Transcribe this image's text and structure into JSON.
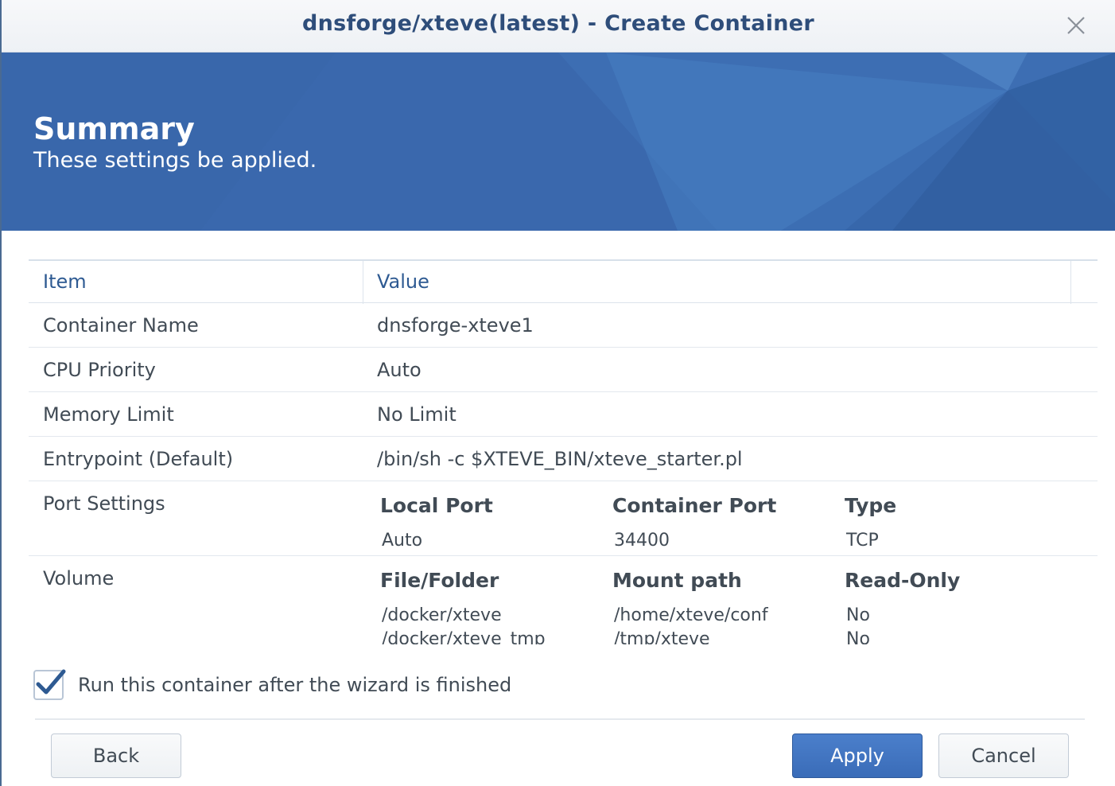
{
  "window": {
    "title": "dnsforge/xteve(latest) - Create Container"
  },
  "banner": {
    "heading": "Summary",
    "subtitle": "These settings be applied."
  },
  "table": {
    "headers": {
      "item": "Item",
      "value": "Value"
    },
    "rows": [
      {
        "item": "Container Name",
        "value": "dnsforge-xteve1"
      },
      {
        "item": "CPU Priority",
        "value": "Auto"
      },
      {
        "item": "Memory Limit",
        "value": "No Limit"
      },
      {
        "item": "Entrypoint (Default)",
        "value": "/bin/sh -c $XTEVE_BIN/xteve_starter.pl"
      }
    ],
    "port_settings": {
      "label": "Port Settings",
      "headers": {
        "local": "Local Port",
        "container": "Container Port",
        "type": "Type"
      },
      "rows": [
        {
          "local": "Auto",
          "container": "34400",
          "type": "TCP"
        }
      ]
    },
    "volume": {
      "label": "Volume",
      "headers": {
        "file": "File/Folder",
        "mount": "Mount path",
        "readonly": "Read-Only"
      },
      "rows": [
        {
          "file": "/docker/xteve",
          "mount": "/home/xteve/conf",
          "readonly": "No"
        },
        {
          "file": "/docker/xteve_tmp",
          "mount": "/tmp/xteve",
          "readonly": "No"
        }
      ]
    }
  },
  "run_after": {
    "label": "Run this container after the wizard is finished",
    "checked": true
  },
  "buttons": {
    "back": "Back",
    "apply": "Apply",
    "cancel": "Cancel"
  },
  "colors": {
    "accent": "#3a6cb8",
    "title": "#2e4d7a",
    "banner": "#3a68ad"
  },
  "icons": {
    "close": "close-icon",
    "check": "checkmark-icon"
  }
}
